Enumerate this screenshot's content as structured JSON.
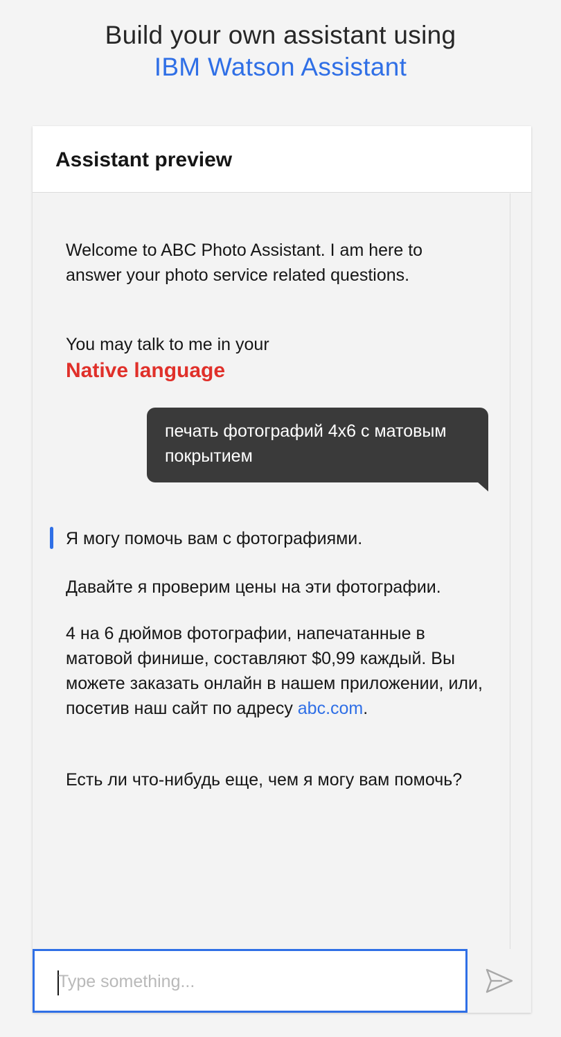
{
  "hero": {
    "line1": "Build your own assistant using",
    "line2": "IBM Watson Assistant"
  },
  "panel": {
    "title": "Assistant preview"
  },
  "chat": {
    "welcome": "Welcome to ABC Photo Assistant. I am here to answer your photo service related questions.",
    "native_intro": "You may talk to me in your",
    "native_label": "Native language",
    "user_message": "печать фотографий 4x6 с матовым покрытием",
    "response": {
      "p1": "Я могу помочь вам с фотографиями.",
      "p2": "Давайте я проверим цены на эти фотографии.",
      "p3_text": "4 на 6 дюймов фотографии, напечатанные в матовой финише, составляют $0,99 каждый. Вы можете заказать онлайн в нашем приложении, или, посетив наш сайт по адресу ",
      "p3_link": "abc.com",
      "p3_end": ".",
      "p4": "Есть ли что-нибудь еще, чем я могу вам помочь?"
    }
  },
  "input": {
    "placeholder": "Type something...",
    "value": ""
  },
  "icons": {
    "send": "send-icon"
  },
  "colors": {
    "accent": "#2f6fe6",
    "native_label": "#e0302a",
    "user_bubble": "#3a3a3a",
    "background": "#f4f4f4"
  }
}
